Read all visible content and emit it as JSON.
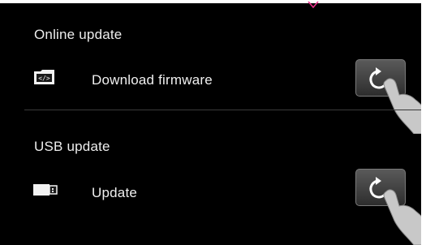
{
  "online_update": {
    "title": "Online update",
    "row": {
      "icon": "folder-code-icon",
      "label": "Download firmware",
      "action_icon": "refresh-icon"
    }
  },
  "usb_update": {
    "title": "USB update",
    "row": {
      "icon": "usb-drive-icon",
      "label": "Update",
      "action_icon": "refresh-icon"
    }
  },
  "colors": {
    "background": "#000000",
    "text": "#f0f0f0",
    "accent": "#e8318a"
  }
}
